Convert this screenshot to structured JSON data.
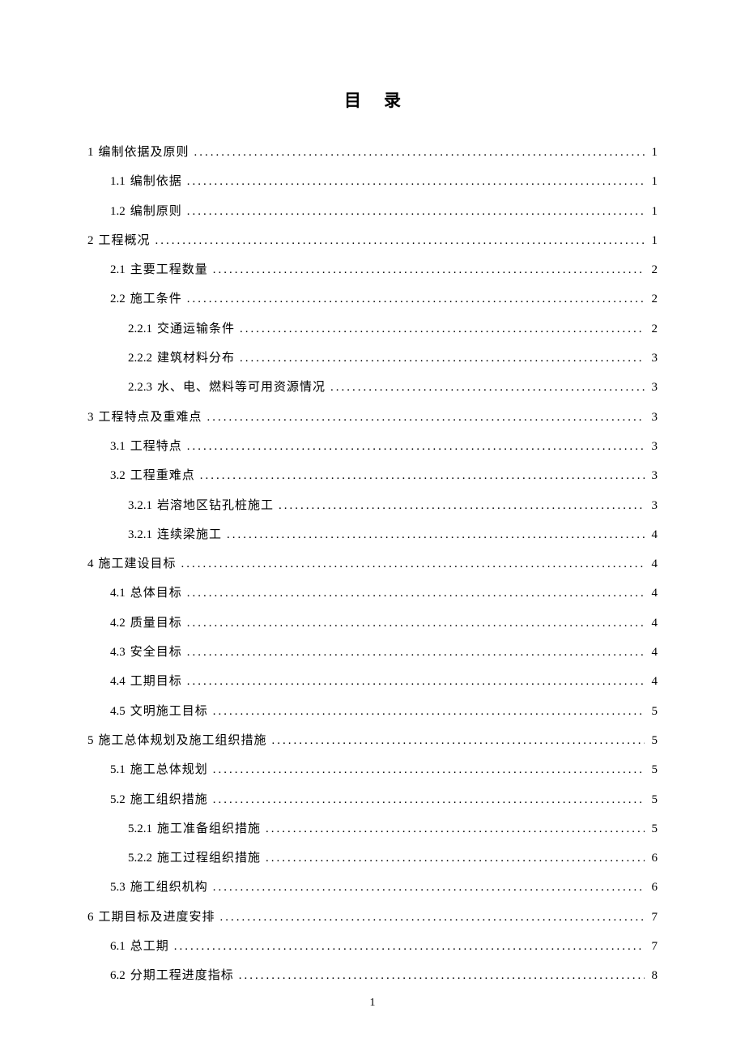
{
  "title": "目录",
  "footer_page": "1",
  "toc": [
    {
      "level": 1,
      "num": "1",
      "label": "编制依据及原则",
      "page": "1"
    },
    {
      "level": 2,
      "num": "1.1",
      "label": "编制依据",
      "page": "1"
    },
    {
      "level": 2,
      "num": "1.2",
      "label": "编制原则",
      "page": "1"
    },
    {
      "level": 1,
      "num": "2",
      "label": "工程概况",
      "page": "1"
    },
    {
      "level": 2,
      "num": "2.1",
      "label": "主要工程数量",
      "page": "2"
    },
    {
      "level": 2,
      "num": "2.2",
      "label": "施工条件",
      "page": "2"
    },
    {
      "level": 3,
      "num": "2.2.1",
      "label": "交通运输条件",
      "page": "2"
    },
    {
      "level": 3,
      "num": "2.2.2",
      "label": "建筑材料分布",
      "page": "3"
    },
    {
      "level": 3,
      "num": "2.2.3",
      "label": "水、电、燃料等可用资源情况",
      "page": "3"
    },
    {
      "level": 1,
      "num": "3",
      "label": "工程特点及重难点",
      "page": "3"
    },
    {
      "level": 2,
      "num": "3.1",
      "label": "工程特点",
      "page": "3"
    },
    {
      "level": 2,
      "num": "3.2",
      "label": "工程重难点",
      "page": "3"
    },
    {
      "level": 3,
      "num": "3.2.1",
      "label": "岩溶地区钻孔桩施工",
      "page": "3"
    },
    {
      "level": 3,
      "num": "3.2.1",
      "label": "连续梁施工",
      "page": "4"
    },
    {
      "level": 1,
      "num": "4",
      "label": "施工建设目标",
      "page": "4"
    },
    {
      "level": 2,
      "num": "4.1",
      "label": "总体目标",
      "page": "4"
    },
    {
      "level": 2,
      "num": "4.2",
      "label": "质量目标",
      "page": "4"
    },
    {
      "level": 2,
      "num": "4.3",
      "label": "安全目标",
      "page": "4"
    },
    {
      "level": 2,
      "num": "4.4",
      "label": "工期目标",
      "page": "4"
    },
    {
      "level": 2,
      "num": "4.5",
      "label": "文明施工目标",
      "page": "5"
    },
    {
      "level": 1,
      "num": "5",
      "label": "施工总体规划及施工组织措施",
      "page": "5"
    },
    {
      "level": 2,
      "num": "5.1",
      "label": "施工总体规划",
      "page": "5"
    },
    {
      "level": 2,
      "num": "5.2",
      "label": "施工组织措施",
      "page": "5"
    },
    {
      "level": 3,
      "num": "5.2.1",
      "label": "施工准备组织措施",
      "page": "5"
    },
    {
      "level": 3,
      "num": "5.2.2",
      "label": "施工过程组织措施",
      "page": "6"
    },
    {
      "level": 2,
      "num": "5.3",
      "label": "施工组织机构",
      "page": "6"
    },
    {
      "level": 1,
      "num": "6",
      "label": "工期目标及进度安排",
      "page": "7"
    },
    {
      "level": 2,
      "num": "6.1",
      "label": "总工期",
      "page": "7"
    },
    {
      "level": 2,
      "num": "6.2",
      "label": "分期工程进度指标",
      "page": "8"
    }
  ]
}
